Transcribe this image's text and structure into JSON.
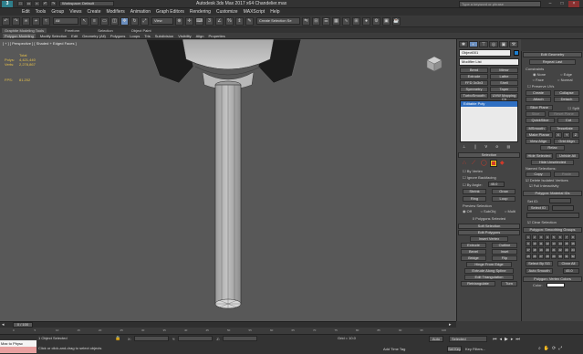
{
  "app": {
    "logo": "3",
    "title": "Autodesk 3ds Max 2017 x64     Chandelier.max",
    "search_placeholder": "Type a keyword or phrase",
    "workspace": "Workspace: Default"
  },
  "menus": [
    "Edit",
    "Tools",
    "Group",
    "Views",
    "Create",
    "Modifiers",
    "Animation",
    "Graph Editors",
    "Rendering",
    "Customize",
    "MAXScript",
    "Help"
  ],
  "toolbar": {
    "selection_filter": "All",
    "ref_coord": "View",
    "named_selection": "Create Selection Se"
  },
  "ribbon": {
    "tabs": [
      "Graphite Modeling Tools",
      "Freeform",
      "Selection",
      "Object Paint"
    ],
    "active_tab": "Graphite Modeling Tools",
    "subtabs": [
      "Polygon Modeling",
      "Modify Selection",
      "Edit",
      "Geometry (All)",
      "Polygons",
      "Loops",
      "Tris",
      "Subdivision",
      "Visibility",
      "Align",
      "Properties"
    ]
  },
  "viewport": {
    "label": "[ + ] [ Perspective ] [ Shaded + Edged Faces ]",
    "stats_header": "Total",
    "polys_label": "Polys:",
    "polys_value": "4,421,440",
    "verts_label": "Verts:",
    "verts_value": "2,278,867",
    "fps_label": "FPS:",
    "fps_value": "81.202"
  },
  "command_panel": {
    "object_name": "Object001",
    "modifier_list": "Modifier List",
    "modifier_buttons": [
      "Bend",
      "Mirror",
      "Extrude",
      "Lathe",
      "FFD 3x3x3",
      "Shell",
      "Symmetry",
      "Taper",
      "TurboSmooth",
      "UVW Mapping Clr"
    ],
    "stack_item": "Editable Poly",
    "selection_title": "Selection",
    "by_vertex": "By Vertex",
    "ignore_backfacing": "Ignore Backfacing",
    "by_angle": "By Angle:",
    "by_angle_value": "45.0",
    "shrink": "Shrink",
    "grow": "Grow",
    "ring": "Ring",
    "loop": "Loop",
    "preview_selection": "Preview Selection",
    "preview_off": "Off",
    "preview_subobj": "SubObj",
    "preview_multi": "Multi",
    "selected_count": "0 Polygons Selected",
    "soft_selection": "Soft Selection",
    "edit_polygons": "Edit Polygons",
    "insert_vertex": "Insert Vertex",
    "extrude": "Extrude",
    "outline": "Outline",
    "bevel": "Bevel",
    "inset": "Inset",
    "bridge": "Bridge",
    "flip": "Flip",
    "hinge_from_edge": "Hinge From Edge",
    "extrude_along_spline": "Extrude Along Spline",
    "edit_triangulation": "Edit Triangulation",
    "retriangulate": "Retriangulate",
    "turn": "Turn"
  },
  "right_panel": {
    "edit_geometry": "Edit Geometry",
    "repeat_last": "Repeat Last",
    "constraints": "Constraints",
    "c_none": "None",
    "c_edge": "Edge",
    "c_face": "Face",
    "c_normal": "Normal",
    "preserve_uvs": "Preserve UVs",
    "create": "Create",
    "collapse": "Collapse",
    "attach": "Attach",
    "detach": "Detach",
    "slice_plane": "Slice Plane",
    "split": "Split",
    "slice": "Slice",
    "reset_plane": "Reset Plane",
    "quickslice": "QuickSlice",
    "cut": "Cut",
    "msmooth": "MSmooth",
    "tessellate": "Tessellate",
    "make_planar": "Make Planar",
    "x": "X",
    "y": "Y",
    "z": "Z",
    "view_align": "View Align",
    "grid_align": "Grid Align",
    "relax": "Relax",
    "hide_selected": "Hide Selected",
    "unhide_all": "Unhide All",
    "hide_unselected": "Hide Unselected",
    "named_selections": "Named Selections:",
    "copy": "Copy",
    "paste": "Paste",
    "delete_isolated": "Delete Isolated Vertices",
    "full_interactivity": "Full Interactivity",
    "material_ids": "Polygon: Material IDs",
    "set_id": "Set ID:",
    "select_id": "Select ID",
    "clear_selection": "Clear Selection",
    "smoothing_groups": "Polygon: Smoothing Groups",
    "sg_numbers": [
      "1",
      "2",
      "3",
      "4",
      "5",
      "6",
      "7",
      "8",
      "9",
      "10",
      "11",
      "12",
      "13",
      "14",
      "15",
      "16",
      "17",
      "18",
      "19",
      "20",
      "21",
      "22",
      "23",
      "24",
      "25",
      "26",
      "27",
      "28",
      "29",
      "30",
      "31",
      "32"
    ],
    "select_by_sg": "Select By SG",
    "clear_all": "Clear All",
    "auto_smooth": "Auto Smooth",
    "auto_smooth_value": "45.0",
    "vertex_colors": "Polygon: Vertex Colors",
    "color": "Color:"
  },
  "timeline": {
    "frame": "0 / 100",
    "ticks": [
      "0",
      "5",
      "10",
      "15",
      "20",
      "25",
      "30",
      "35",
      "40",
      "45",
      "50",
      "55",
      "60",
      "65",
      "70",
      "75",
      "80",
      "85",
      "90",
      "95",
      "100"
    ]
  },
  "status": {
    "maxscript": "Max to Physc",
    "selected": "1 Object Selected",
    "prompt": "Click or click-and-drag to select objects",
    "x_label": "X:",
    "y_label": "Y:",
    "z_label": "Z:",
    "grid": "Grid = 10.0",
    "add_time_tag": "Add Time Tag",
    "auto": "Auto",
    "selected_dd": "Selected",
    "set_key": "Set Key",
    "key_filters": "Key Filters..."
  },
  "colors": {
    "accent_blue": "#6b8fbf",
    "stats_yellow": "#e8c24a",
    "highlight_red": "#d23a2a"
  }
}
